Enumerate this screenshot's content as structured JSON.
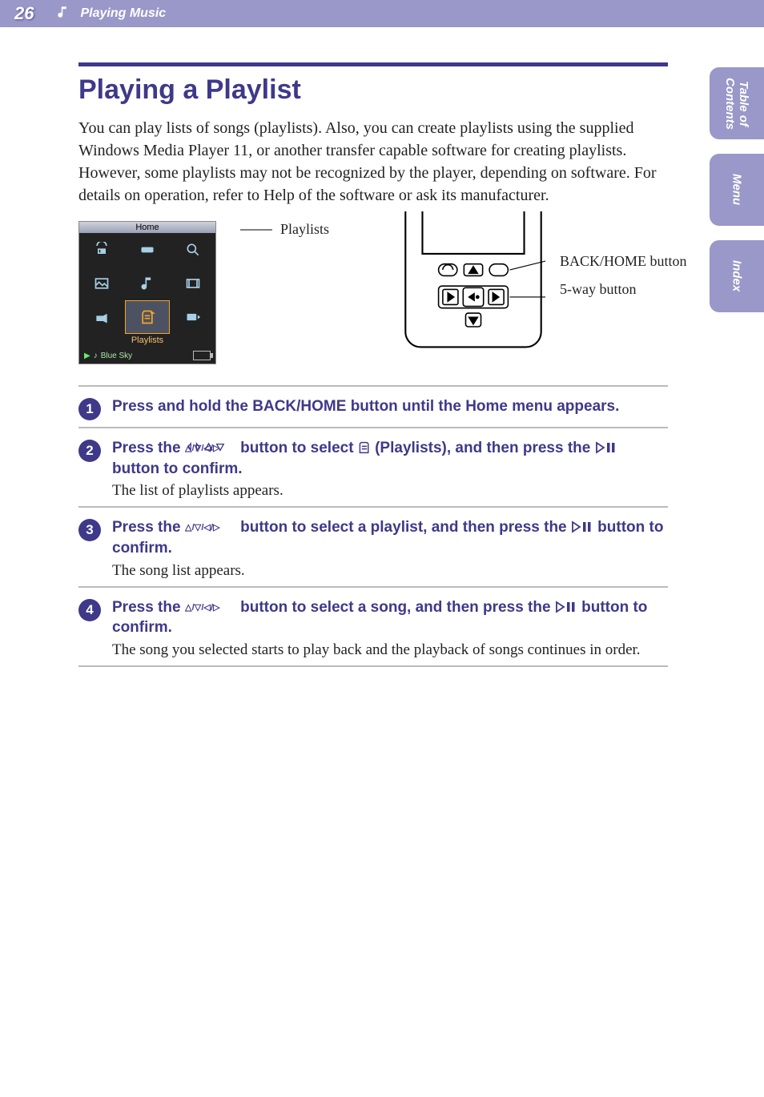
{
  "header": {
    "page_number": "26",
    "section": "Playing Music"
  },
  "side_tabs": {
    "toc_line1": "Table of",
    "toc_line2": "Contents",
    "menu": "Menu",
    "index": "Index"
  },
  "title": "Playing a Playlist",
  "intro": "You can play lists of songs (playlists). Also, you can create playlists using the supplied Windows Media Player 11, or another transfer capable software for creating playlists. However, some playlists may not be recognized by the player, depending on software. For details on operation, refer to Help of the software or ask its manufacturer.",
  "screenshot": {
    "title": "Home",
    "selected_label": "Playlists",
    "now_playing": "Blue Sky",
    "callout": "Playlists"
  },
  "device": {
    "back_home_label": "BACK/HOME button",
    "five_way_label": "5-way button"
  },
  "steps": [
    {
      "lead_plain": "Press and hold the BACK/HOME button until the Home menu appears.",
      "desc": ""
    },
    {
      "lead_prefix": "Press the ",
      "lead_mid": " button to select ",
      "lead_suffix1": " (Playlists), and then press the ",
      "lead_suffix2": " button to confirm.",
      "desc": "The list of playlists appears."
    },
    {
      "lead_prefix": "Press the ",
      "lead_mid": " button to select a playlist, and then press the ",
      "lead_suffix": " button to confirm.",
      "desc": "The song list appears."
    },
    {
      "lead_prefix": "Press the ",
      "lead_mid": " button to select a song, and then press the ",
      "lead_suffix": " button to confirm.",
      "desc": "The song you selected starts to play back and the playback of songs continues in order."
    }
  ]
}
